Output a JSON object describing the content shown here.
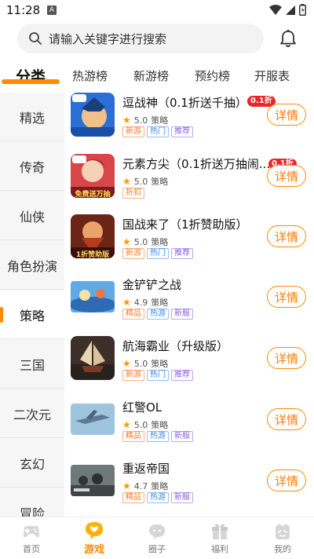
{
  "status": {
    "time": "11:28",
    "notif_letter": "A"
  },
  "search": {
    "placeholder": "请输入关键字进行搜索"
  },
  "tabs": [
    {
      "label": "分类"
    },
    {
      "label": "热游榜"
    },
    {
      "label": "新游榜"
    },
    {
      "label": "预约榜"
    },
    {
      "label": "开服表"
    }
  ],
  "sidebar": {
    "items": [
      {
        "label": "精选"
      },
      {
        "label": "传奇"
      },
      {
        "label": "仙侠"
      },
      {
        "label": "角色扮演"
      },
      {
        "label": "策略"
      },
      {
        "label": "三国"
      },
      {
        "label": "二次元"
      },
      {
        "label": "玄幻"
      },
      {
        "label": "冒险"
      }
    ],
    "active_label": "策略"
  },
  "games": [
    {
      "name": "逗战神（0.1折送千抽）",
      "rating": "5.0",
      "category": "策略",
      "tags": [
        "新游",
        "热门",
        "推荐"
      ],
      "badge": "0.1折",
      "button": "详情"
    },
    {
      "name": "元素方尖（0.1折送万抽闹...",
      "rating": "5.0",
      "category": "策略",
      "tags": [
        "折扣"
      ],
      "badge": "0.1折",
      "thumb_text": "免费送万抽",
      "button": "详情"
    },
    {
      "name": "国战来了（1折赞助版）",
      "rating": "5.0",
      "category": "策略",
      "tags": [
        "新游",
        "热门",
        "推荐"
      ],
      "thumb_text": "1折赞助版",
      "button": "详情"
    },
    {
      "name": "金铲铲之战",
      "rating": "4.9",
      "category": "策略",
      "tags": [
        "精品",
        "热游",
        "新服"
      ],
      "button": "详情"
    },
    {
      "name": "航海霸业（升级版）",
      "rating": "5.0",
      "category": "策略",
      "tags": [
        "新游",
        "热门",
        "推荐"
      ],
      "button": "详情"
    },
    {
      "name": "红警OL",
      "rating": "5.0",
      "category": "策略",
      "tags": [
        "精品",
        "热游",
        "新服"
      ],
      "button": "详情"
    },
    {
      "name": "重返帝国",
      "rating": "4.7",
      "category": "策略",
      "tags": [
        "精品",
        "热游",
        "新服"
      ],
      "button": "详情"
    }
  ],
  "bottom_nav": [
    {
      "label": "首页",
      "icon": "gamepad-icon"
    },
    {
      "label": "游戏",
      "icon": "heart-bubble-icon"
    },
    {
      "label": "圈子",
      "icon": "chat-bubble-icon"
    },
    {
      "label": "福利",
      "icon": "gift-icon"
    },
    {
      "label": "我的",
      "icon": "profile-icon"
    }
  ],
  "colors": {
    "accent": "#ff8a00",
    "badge_red": "#e8262b"
  }
}
